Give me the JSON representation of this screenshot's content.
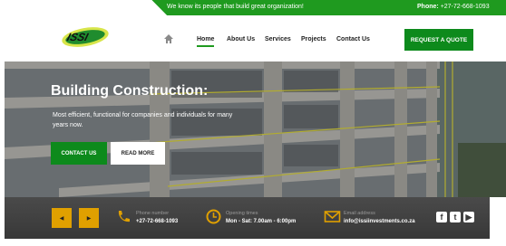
{
  "topbar": {
    "tagline": "We know its people that build great organization!",
    "phone_label": "Phone:",
    "phone_value": "+27-72-668-1093"
  },
  "header": {
    "logo_text": "ISSI",
    "nav": [
      {
        "label": "Home",
        "active": true
      },
      {
        "label": "About Us",
        "active": false
      },
      {
        "label": "Services",
        "active": false
      },
      {
        "label": "Projects",
        "active": false
      },
      {
        "label": "Contact Us",
        "active": false
      }
    ],
    "cta_label": "REQUEST A QUOTE"
  },
  "hero": {
    "title": "Building Construction:",
    "text": "Most efficient, functional for companies and individuals for many years now.",
    "btn_contact": "CONTACT US",
    "btn_read": "READ MORE"
  },
  "infobar": {
    "prev_icon": "chevron-left-icon",
    "next_icon": "chevron-right-icon",
    "phone_label": "Phone number",
    "phone_value": "+27-72-668-1093",
    "hours_label": "Opening times",
    "hours_value": "Mon - Sat: 7.00am - 6:00pm",
    "email_label": "Email address",
    "email_value": "info@issiinvestments.co.za",
    "socials": [
      "facebook-icon",
      "twitter-icon",
      "youtube-icon"
    ]
  },
  "colors": {
    "brand_green": "#0d8a1c",
    "top_green": "#1f9a1f",
    "accent_amber": "#e0a000",
    "info_bar": "#3f3f3f"
  }
}
